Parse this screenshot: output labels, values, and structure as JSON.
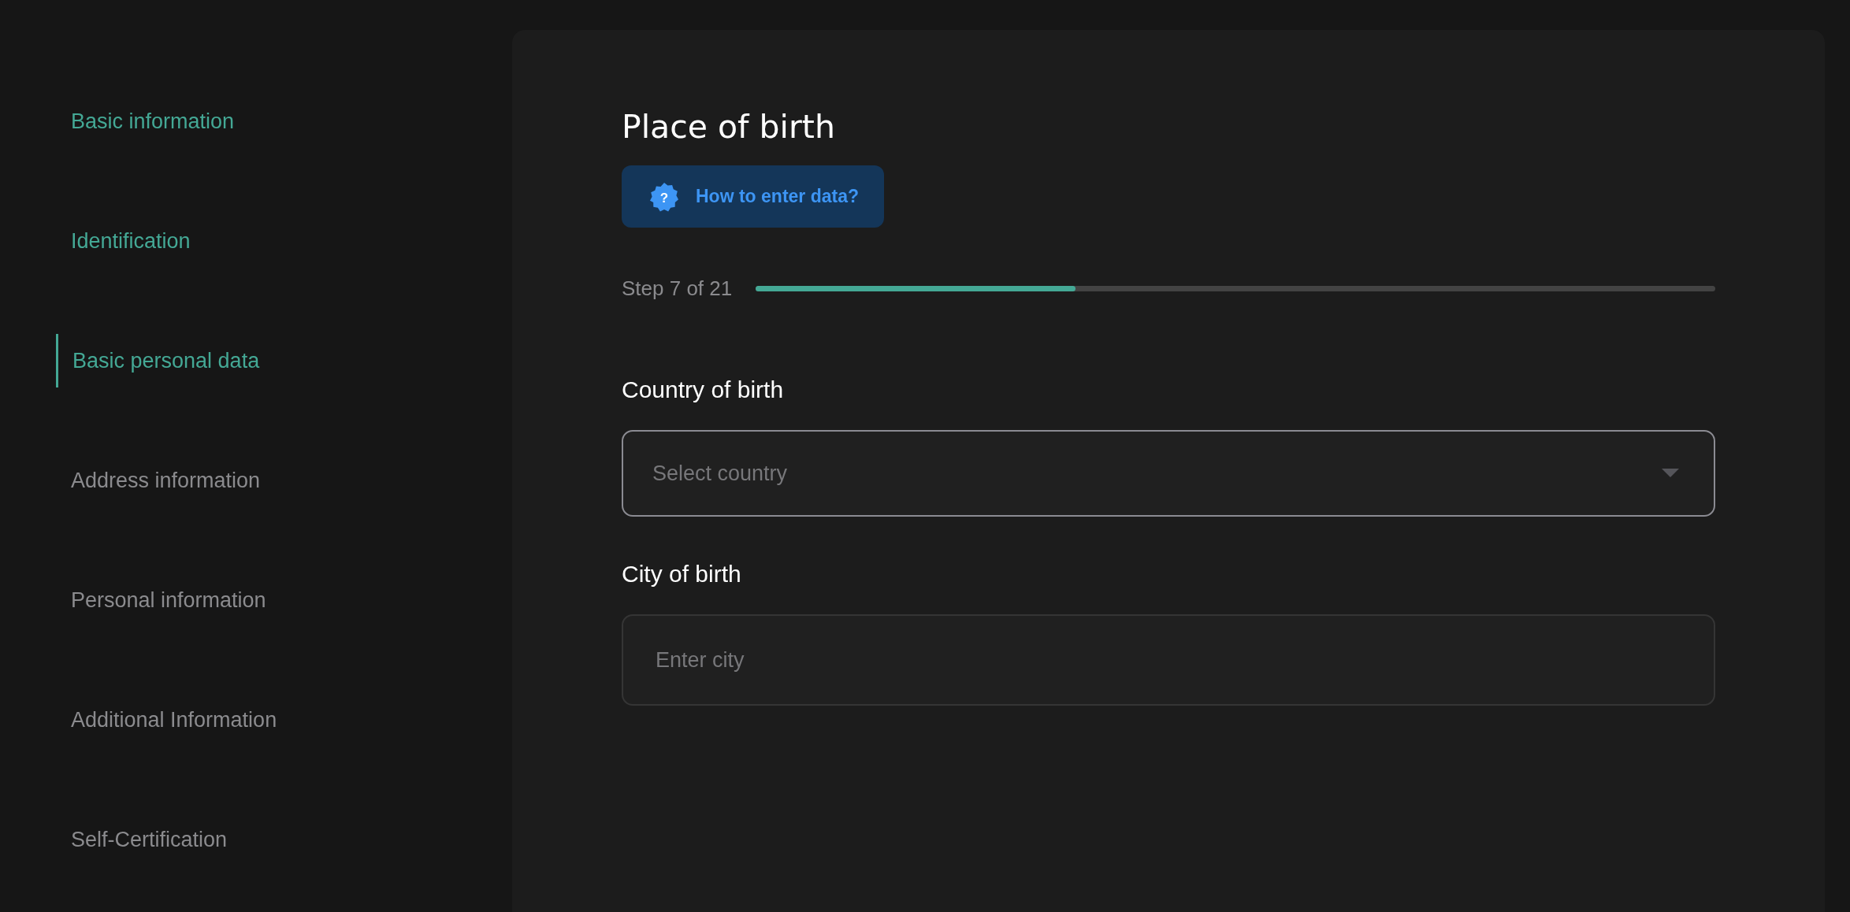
{
  "sidebar": {
    "items": [
      {
        "label": "Basic information",
        "completed": true,
        "selected": false
      },
      {
        "label": "Identification",
        "completed": true,
        "selected": false
      },
      {
        "label": "Basic personal data",
        "completed": true,
        "selected": true
      },
      {
        "label": "Address information",
        "completed": false,
        "selected": false
      },
      {
        "label": "Personal information",
        "completed": false,
        "selected": false
      },
      {
        "label": "Additional Information",
        "completed": false,
        "selected": false
      },
      {
        "label": "Self-Certification",
        "completed": false,
        "selected": false
      }
    ]
  },
  "form": {
    "title": "Place of birth",
    "help_button": "How to enter data?",
    "help_icon": "?",
    "progress": {
      "label": "Step 7 of 21",
      "level": 0.333
    },
    "fields": [
      {
        "kind": "select",
        "label": "Country of birth",
        "placeholder": "Select country"
      },
      {
        "kind": "text",
        "label": "City of birth",
        "placeholder": "Enter city"
      }
    ]
  }
}
